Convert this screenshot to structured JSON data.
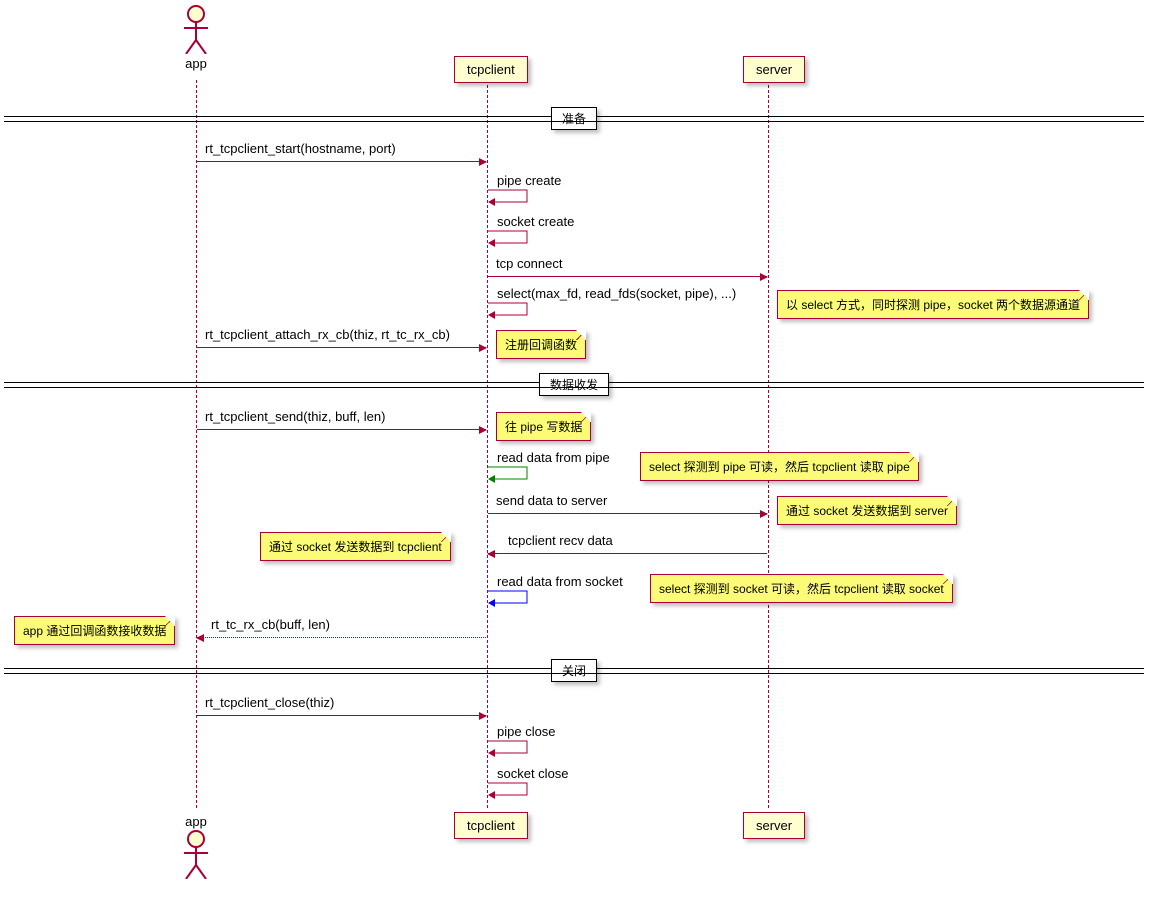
{
  "actors": {
    "app": "app",
    "tcpclient": "tcpclient",
    "server": "server"
  },
  "dividers": {
    "prepare": "准备",
    "data": "数据收发",
    "close": "关闭"
  },
  "messages": {
    "m1": "rt_tcpclient_start(hostname, port)",
    "m2": "pipe create",
    "m3": "socket create",
    "m4": "tcp connect",
    "m5": "select(max_fd, read_fds(socket, pipe), ...)",
    "m6": "rt_tcpclient_attach_rx_cb(thiz, rt_tc_rx_cb)",
    "m7": "rt_tcpclient_send(thiz, buff, len)",
    "m8": "read data from pipe",
    "m9": "send data to server",
    "m10": "tcpclient recv data",
    "m11": "read data from socket",
    "m12": "rt_tc_rx_cb(buff, len)",
    "m13": "rt_tcpclient_close(thiz)",
    "m14": "pipe close",
    "m15": "socket close"
  },
  "notes": {
    "n_select": "以 select 方式，同时探测 pipe，socket 两个数据源通道",
    "n_attach": "注册回调函数",
    "n_send": "往 pipe 写数据",
    "n_readpipe": "select 探测到 pipe 可读，然后 tcpclient 读取 pipe",
    "n_sendserver": "通过 socket 发送数据到 server",
    "n_recv": "通过 socket 发送数据到 tcpclient",
    "n_readsock": "select 探测到 socket 可读，然后 tcpclient 读取 socket",
    "n_cb": "app 通过回调函数接收数据"
  },
  "colors": {
    "line": "#A80036",
    "green": "#008000",
    "blue": "#0000FF"
  }
}
